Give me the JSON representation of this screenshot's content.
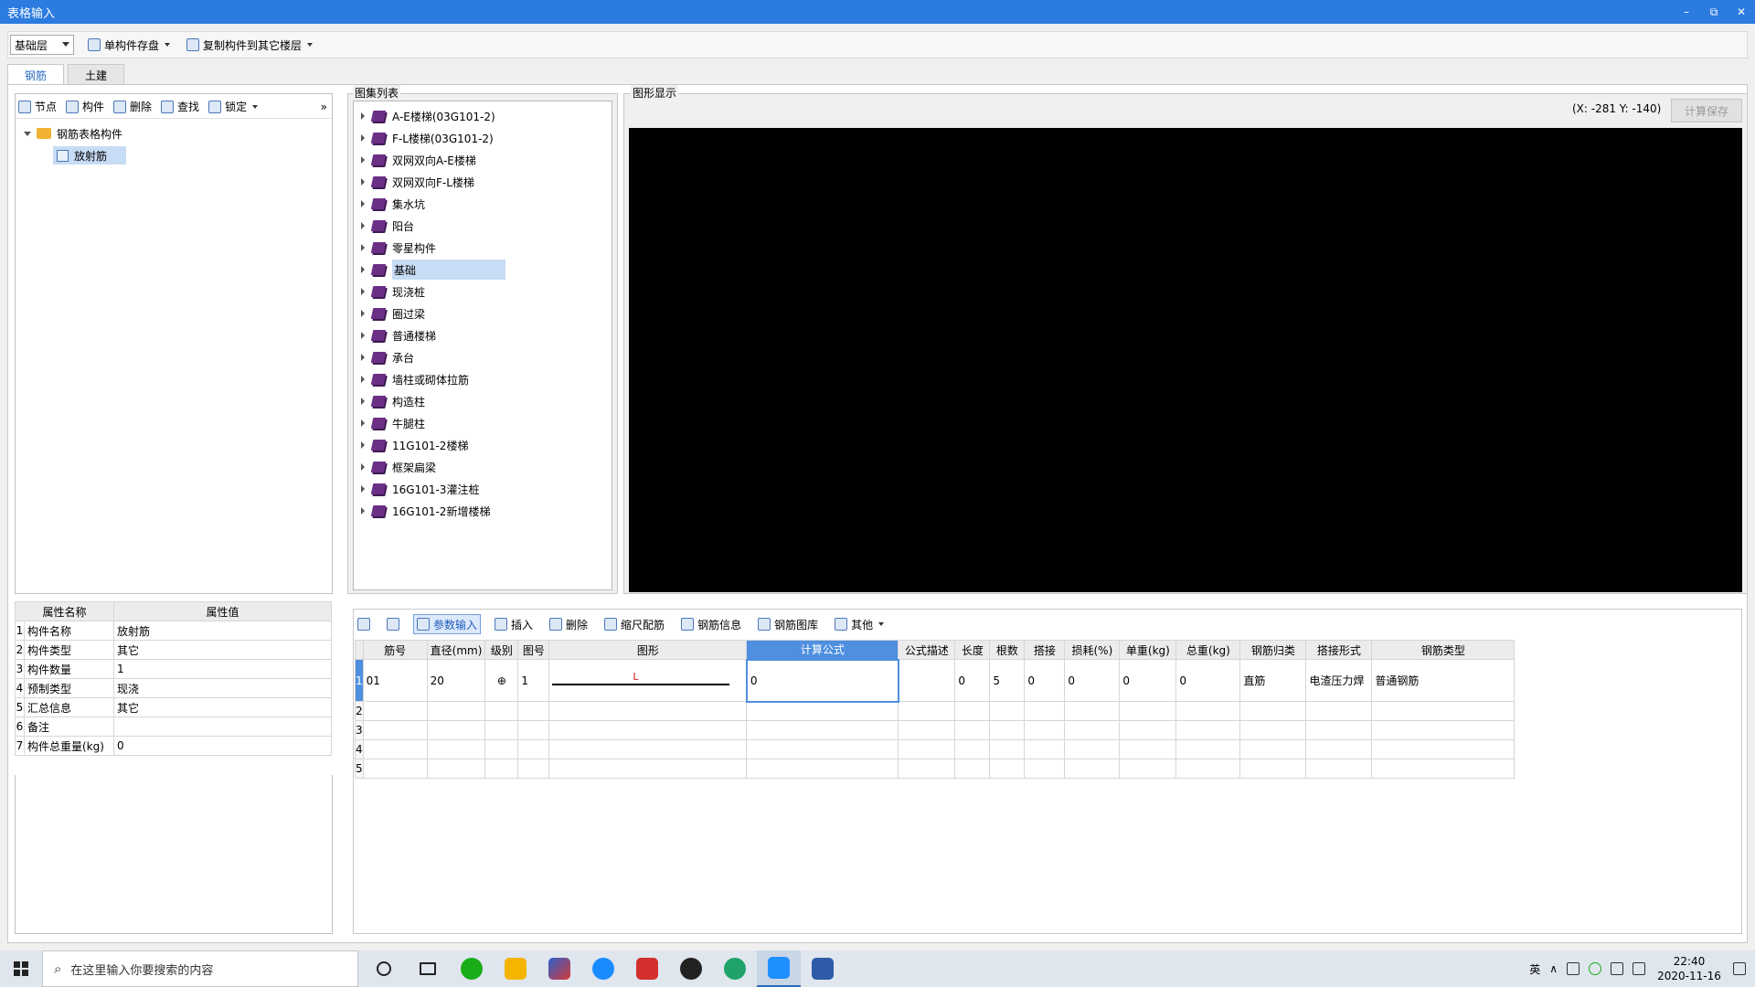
{
  "window": {
    "title": "表格输入",
    "controls": [
      "–",
      "⧉",
      "✕"
    ]
  },
  "toolbar": {
    "floor_value": "基础层",
    "save_component_label": "单构件存盘",
    "copy_component_label": "复制构件到其它楼层"
  },
  "tabs": [
    {
      "label": "钢筋",
      "active": true
    },
    {
      "label": "土建",
      "active": false
    }
  ],
  "left_toolbar": {
    "node": "节点",
    "component": "构件",
    "delete": "删除",
    "find": "查找",
    "lock": "锁定",
    "more": "»"
  },
  "tree": {
    "root": "钢筋表格构件",
    "child": "放射筋"
  },
  "atlas": {
    "title": "图集列表",
    "items": [
      "A-E楼梯(03G101-2)",
      "F-L楼梯(03G101-2)",
      "双网双向A-E楼梯",
      "双网双向F-L楼梯",
      "集水坑",
      "阳台",
      "零星构件",
      "基础",
      "现浇桩",
      "圈过梁",
      "普通楼梯",
      "承台",
      "墙柱或砌体拉筋",
      "构造柱",
      "牛腿柱",
      "11G101-2楼梯",
      "框架扁梁",
      "16G101-3灌注桩",
      "16G101-2新增楼梯"
    ],
    "selected": "基础"
  },
  "graphic": {
    "title": "图形显示",
    "coords": "(X: -281 Y: -140)",
    "calc_save": "计算保存"
  },
  "properties": {
    "headers": [
      "属性名称",
      "属性值"
    ],
    "rows": [
      {
        "n": "1",
        "name": "构件名称",
        "value": "放射筋"
      },
      {
        "n": "2",
        "name": "构件类型",
        "value": "其它"
      },
      {
        "n": "3",
        "name": "构件数量",
        "value": "1"
      },
      {
        "n": "4",
        "name": "预制类型",
        "value": "现浇"
      },
      {
        "n": "5",
        "name": "汇总信息",
        "value": "其它"
      },
      {
        "n": "6",
        "name": "备注",
        "value": ""
      },
      {
        "n": "7",
        "name": "构件总重量(kg)",
        "value": "0"
      }
    ]
  },
  "rebar_toolbar": {
    "param_input": "参数输入",
    "insert": "插入",
    "delete": "删除",
    "scale": "缩尺配筋",
    "info": "钢筋信息",
    "library": "钢筋图库",
    "other": "其他"
  },
  "rebar_grid": {
    "headers": [
      "筋号",
      "直径(mm)",
      "级别",
      "图号",
      "图形",
      "计算公式",
      "公式描述",
      "长度",
      "根数",
      "搭接",
      "损耗(%)",
      "单重(kg)",
      "总重(kg)",
      "钢筋归类",
      "搭接形式",
      "钢筋类型"
    ],
    "row1": {
      "n": "1",
      "id": "01",
      "diameter": "20",
      "grade": "⊕",
      "fig_no": "1",
      "shape_label": "L",
      "formula": "0",
      "desc": "",
      "length": "0",
      "count": "5",
      "lap": "0",
      "loss": "0",
      "unit_weight": "0",
      "total_weight": "0",
      "category": "直筋",
      "lap_type": "电渣压力焊",
      "rebar_type": "普通钢筋"
    },
    "empty_rows": [
      "2",
      "3",
      "4",
      "5"
    ]
  },
  "taskbar": {
    "search_placeholder": "在这里输入你要搜索的内容",
    "time": "22:40",
    "date": "2020-11-16",
    "ime": "英"
  }
}
